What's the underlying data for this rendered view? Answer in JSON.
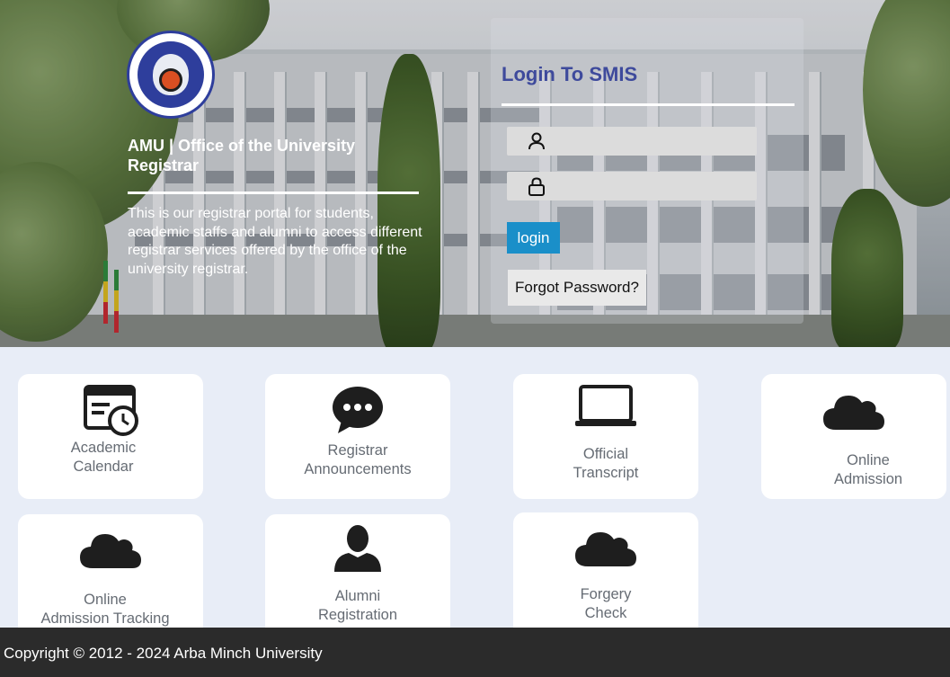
{
  "header": {
    "logo_icon": "arba-minch-university-seal",
    "logo_text": "ARBA MINCH UNIVERSITY",
    "title": "AMU | Office of the University Registrar",
    "description": "This is our registrar portal for students, academic staffs and alumni to access different registrar services offered by the office of the university registrar."
  },
  "login": {
    "title": "Login To SMIS",
    "username": {
      "icon": "user-icon",
      "value": ""
    },
    "password": {
      "icon": "lock-icon",
      "value": ""
    },
    "login_label": "login",
    "forgot_label": "Forgot Password?",
    "accent_color": "#1a8fc9",
    "title_color": "#3e4a9c"
  },
  "services": [
    {
      "label": "Academic\nCalendar",
      "icon": "calendar-clock-icon"
    },
    {
      "label": "Registrar\nAnnouncements",
      "icon": "chat-bubble-icon"
    },
    {
      "label": "Official\nTranscript",
      "icon": "laptop-icon"
    },
    {
      "label": "Online\nAdmission",
      "icon": "cloud-icon"
    },
    {
      "label": "Online\nAdmission Tracking",
      "icon": "cloud-icon"
    },
    {
      "label": "Alumni\nRegistration",
      "icon": "person-icon"
    },
    {
      "label": "Forgery\nCheck",
      "icon": "cloud-icon"
    }
  ],
  "footer": {
    "copyright": "Copyright © 2012 - 2024 Arba Minch University"
  }
}
